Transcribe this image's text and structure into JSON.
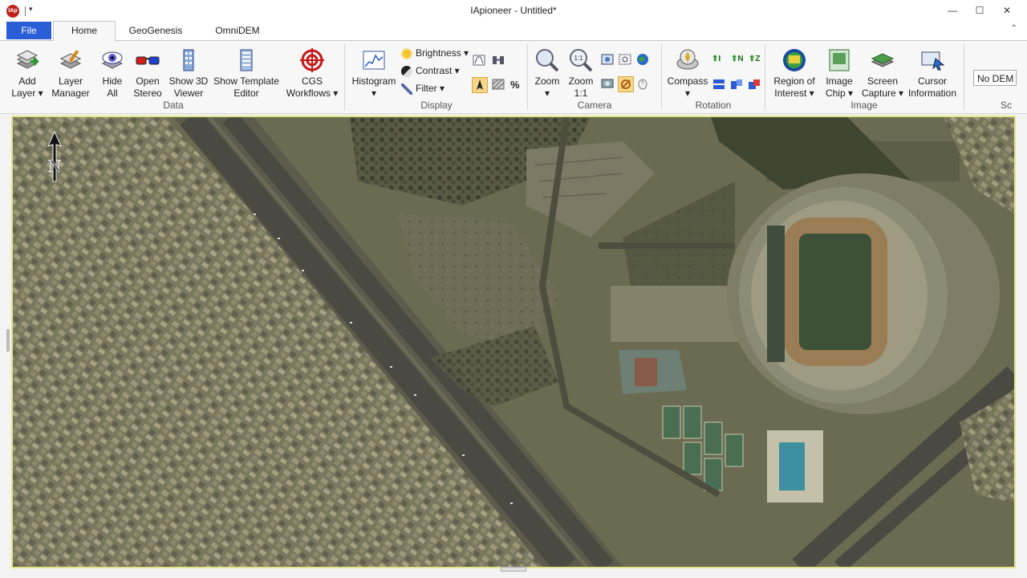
{
  "window": {
    "title": "IApioneer - Untitled*",
    "app_icon_text": "IAp",
    "minimize_glyph": "—",
    "maximize_glyph": "☐",
    "close_glyph": "✕",
    "qat_dropdown_glyph": "▾"
  },
  "tabs": {
    "file": "File",
    "home": "Home",
    "geogenesis": "GeoGenesis",
    "omnidem": "OmniDEM",
    "collapse_glyph": "⌃"
  },
  "ribbon": {
    "data": {
      "label": "Data",
      "add_layer": [
        "Add",
        "Layer ▾"
      ],
      "layer_manager": [
        "Layer",
        "Manager"
      ],
      "hide_all": [
        "Hide",
        "All"
      ],
      "open_stereo": [
        "Open",
        "Stereo"
      ],
      "show_3d_viewer": [
        "Show 3D",
        "Viewer"
      ],
      "show_template_editor": [
        "Show Template",
        "Editor"
      ],
      "cgs_workflows": [
        "CGS",
        "Workflows ▾"
      ]
    },
    "display": {
      "label": "Display",
      "histogram": [
        "Histogram",
        "▾"
      ],
      "brightness": "Brightness ▾",
      "contrast": "Contrast ▾",
      "filter": "Filter ▾",
      "percent": "%"
    },
    "camera": {
      "label": "Camera",
      "zoom": [
        "Zoom",
        "▾"
      ],
      "zoom_1_1": [
        "Zoom",
        "1:1"
      ],
      "zoom11_icon_text": "1:1"
    },
    "rotation": {
      "label": "Rotation",
      "compass": [
        "Compass",
        "▾"
      ],
      "rot_labels": [
        "I",
        "N",
        "Z"
      ]
    },
    "image": {
      "label": "Image",
      "region_of_interest": [
        "Region of",
        "Interest ▾"
      ],
      "image_chip": [
        "Image",
        "Chip ▾"
      ],
      "screen_capture": [
        "Screen",
        "Capture ▾"
      ],
      "cursor_information": [
        "Cursor",
        "Information"
      ]
    },
    "scene": {
      "dem_select_value": "No DEM",
      "label_partial": "Sc"
    }
  },
  "viewer": {
    "north_letter": "N",
    "colors": {
      "ground": "#6b6b51",
      "urban": "#7d7a63",
      "highway": "#4a4a42",
      "pitch": "#3d5038",
      "track": "#9a7d55",
      "pool": "#3d8fa0",
      "vegetation": "#3e4530"
    }
  }
}
